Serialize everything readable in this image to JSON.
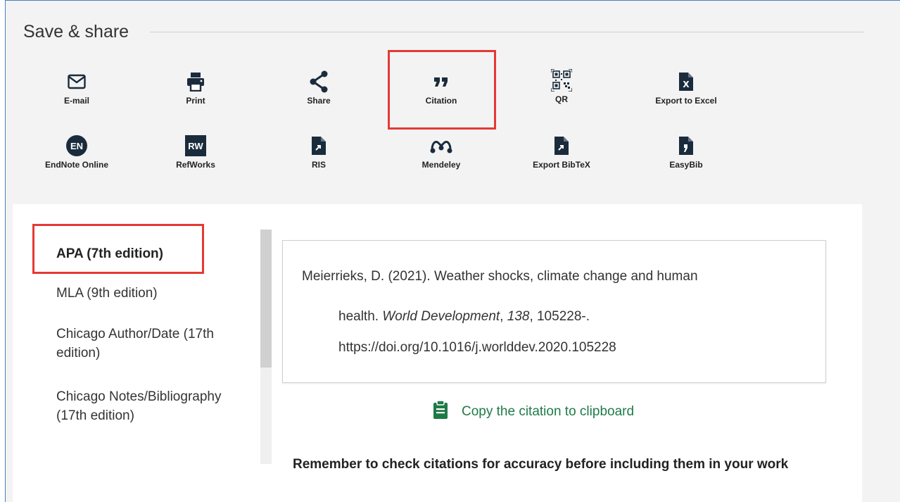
{
  "header": {
    "title": "Save & share"
  },
  "tools_row1": [
    {
      "label": "E-mail",
      "icon": "envelope-icon"
    },
    {
      "label": "Print",
      "icon": "printer-icon"
    },
    {
      "label": "Share",
      "icon": "share-icon"
    },
    {
      "label": "Citation",
      "icon": "quote-icon"
    },
    {
      "label": "QR",
      "icon": "qr-code-icon"
    },
    {
      "label": "Export to Excel",
      "icon": "excel-file-icon"
    }
  ],
  "tools_row2": [
    {
      "label": "EndNote Online",
      "icon": "endnote-icon",
      "badge": "EN"
    },
    {
      "label": "RefWorks",
      "icon": "refworks-icon",
      "badge": "RW"
    },
    {
      "label": "RIS",
      "icon": "ris-file-icon"
    },
    {
      "label": "Mendeley",
      "icon": "mendeley-icon"
    },
    {
      "label": "Export BibTeX",
      "icon": "bibtex-file-icon"
    },
    {
      "label": "EasyBib",
      "icon": "easybib-file-icon"
    }
  ],
  "citation_styles": [
    {
      "label": "APA (7th edition)",
      "active": true
    },
    {
      "label": "MLA (9th edition)"
    },
    {
      "label": "Chicago Author/Date (17th edition)"
    },
    {
      "label": "Chicago Notes/Bibliography (17th edition)"
    }
  ],
  "citation": {
    "line1": "Meierrieks, D. (2021). Weather shocks, climate change and human",
    "line2_prefix": "health. ",
    "journal": "World Development",
    "sep1": ", ",
    "volume": "138",
    "line2_suffix": ", 105228-.",
    "line3": "https://doi.org/10.1016/j.worlddev.2020.105228"
  },
  "copy_label": "Copy the citation to clipboard",
  "reminder": "Remember to check citations for accuracy before including them in your work",
  "colors": {
    "highlight": "#e53935",
    "copy_green": "#1e7b48",
    "icon_dark": "#1a2b3c"
  }
}
